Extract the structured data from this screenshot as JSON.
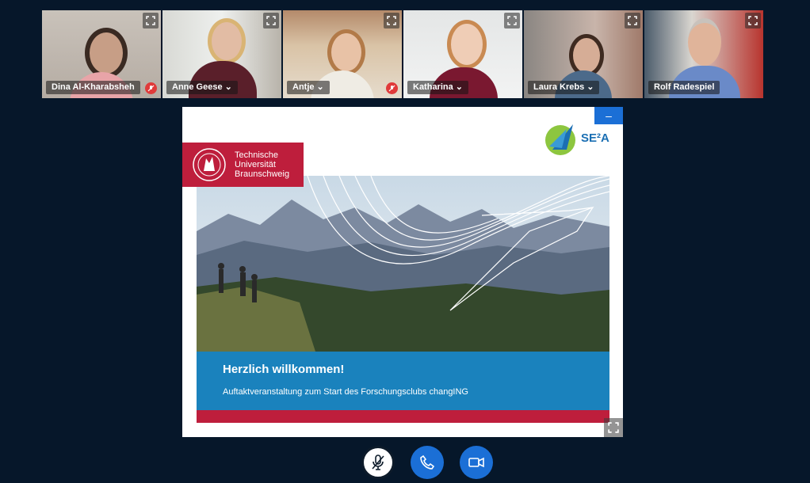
{
  "participants": [
    {
      "name": "Dina Al-Kharabsheh",
      "muted": true
    },
    {
      "name": "Anne Geese ⌄",
      "muted": false
    },
    {
      "name": "Antje ⌄",
      "muted": true
    },
    {
      "name": "Katharina ⌄",
      "muted": false
    },
    {
      "name": "Laura Krebs ⌄",
      "muted": false
    },
    {
      "name": "Rolf Radespiel",
      "muted": false
    }
  ],
  "presentation": {
    "minimize_label": "–",
    "university": {
      "line1": "Technische",
      "line2": "Universität",
      "line3": "Braunschweig"
    },
    "partner_logo": "SE²A",
    "title": "Herzlich willkommen!",
    "subtitle": "Auftaktveranstaltung zum Start des Forschungsclubs changING"
  },
  "controls": {
    "mic": "microphone-muted-icon",
    "phone": "phone-icon",
    "camera": "video-camera-icon"
  }
}
